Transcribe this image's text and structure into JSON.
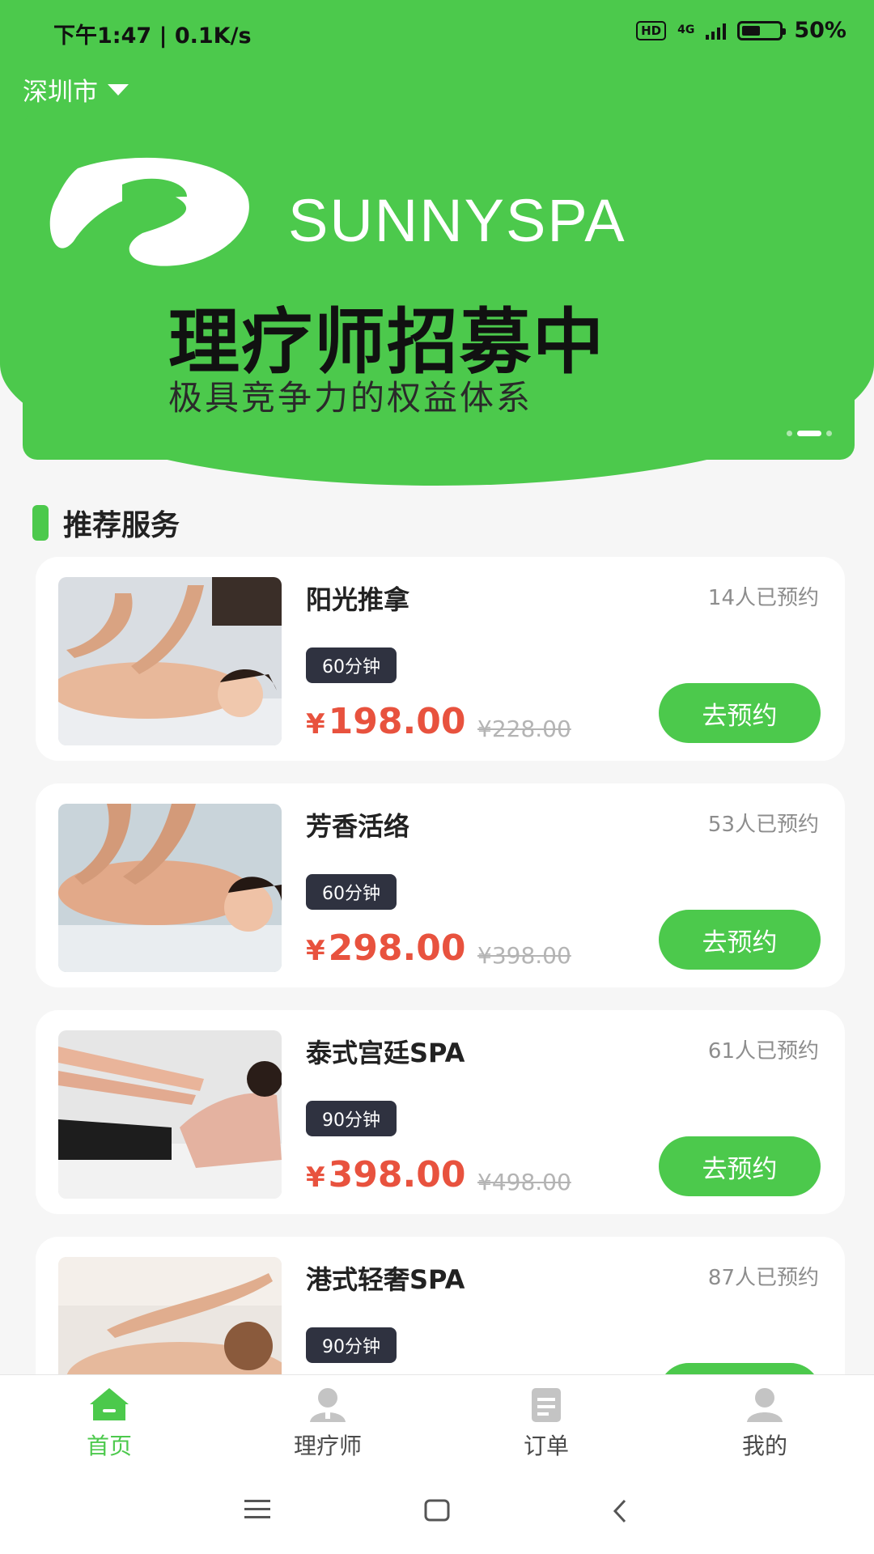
{
  "status_bar": {
    "time": "下午1:47",
    "speed": "0.1K/s",
    "hd": "HD",
    "network": "4G",
    "battery": "50%",
    "battery_level": 0.5
  },
  "header": {
    "city": "深圳市"
  },
  "banner": {
    "brand": "SUNNYSPA",
    "headline": "理疗师招募中",
    "subline": "极具竞争力的权益体系",
    "slide_count": 3,
    "active_slide": 2
  },
  "section": {
    "title": "推荐服务"
  },
  "services": [
    {
      "name": "阳光推拿",
      "booked": "14人已预约",
      "duration": "60分钟",
      "price": "198.00",
      "original_price": "¥228.00",
      "currency": "¥",
      "button": "去预约"
    },
    {
      "name": "芳香活络",
      "booked": "53人已预约",
      "duration": "60分钟",
      "price": "298.00",
      "original_price": "¥398.00",
      "currency": "¥",
      "button": "去预约"
    },
    {
      "name": "泰式宫廷SPA",
      "booked": "61人已预约",
      "duration": "90分钟",
      "price": "398.00",
      "original_price": "¥498.00",
      "currency": "¥",
      "button": "去预约"
    },
    {
      "name": "港式轻奢SPA",
      "booked": "87人已预约",
      "duration": "90分钟",
      "price": "",
      "original_price": "",
      "currency": "",
      "button": ""
    }
  ],
  "tabs": [
    {
      "label": "首页",
      "icon": "home-icon",
      "active": true
    },
    {
      "label": "理疗师",
      "icon": "therapist-icon",
      "active": false
    },
    {
      "label": "订单",
      "icon": "order-icon",
      "active": false
    },
    {
      "label": "我的",
      "icon": "profile-icon",
      "active": false
    }
  ],
  "colors": {
    "accent": "#4cc94c",
    "price": "#e8523e",
    "badge": "#2f3240"
  }
}
